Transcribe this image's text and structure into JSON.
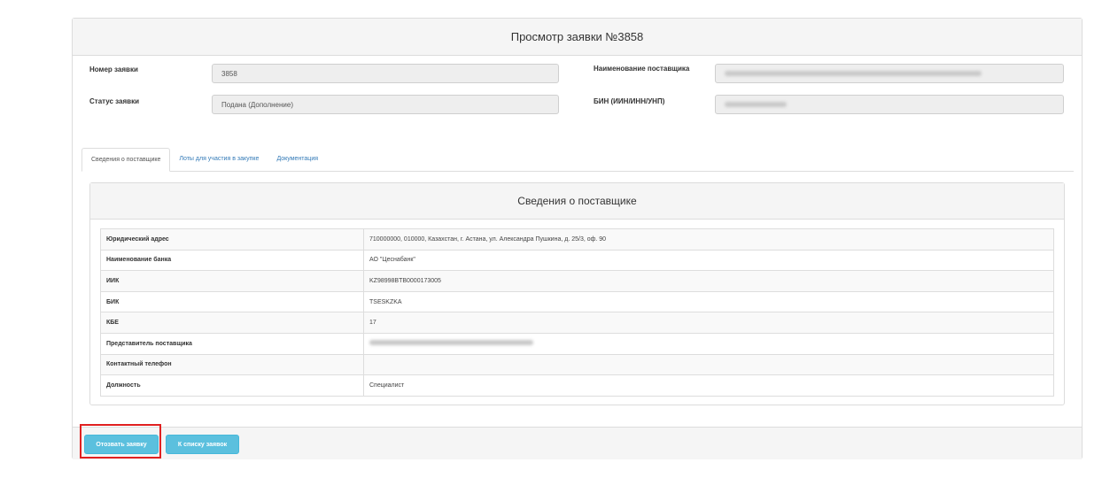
{
  "page": {
    "title": "Просмотр заявки №3858"
  },
  "form": {
    "number_label": "Номер заявки",
    "number_value": "3858",
    "status_label": "Статус заявки",
    "status_value": "Подана (Дополнение)",
    "supplier_name_label": "Наименование поставщика",
    "bin_label": "БИН (ИИН/ИНН/УНП)"
  },
  "tabs": [
    {
      "label": "Сведения о поставщике",
      "active": true
    },
    {
      "label": "Лоты для участия в закупке",
      "active": false
    },
    {
      "label": "Документация",
      "active": false
    }
  ],
  "supplier_info": {
    "title": "Сведения о поставщике",
    "rows": [
      {
        "key": "Юридический адрес",
        "value": "710000000, 010000, Казахстан, г. Астана, ул. Александра Пушкина, д. 25/3, оф. 90"
      },
      {
        "key": "Наименование банка",
        "value": "АО \"Цеснабанк\""
      },
      {
        "key": "ИИК",
        "value": "KZ98998BTB0000173005"
      },
      {
        "key": "БИК",
        "value": "TSESKZKA"
      },
      {
        "key": "КБЕ",
        "value": "17"
      },
      {
        "key": "Представитель поставщика",
        "value": ""
      },
      {
        "key": "Контактный телефон",
        "value": ""
      },
      {
        "key": "Должность",
        "value": "Специалист"
      }
    ]
  },
  "actions": {
    "withdraw_label": "Отозвать заявку",
    "back_label": "К списку заявок"
  },
  "colors": {
    "info_button": "#5bc0de",
    "highlight_border": "#e02020"
  }
}
